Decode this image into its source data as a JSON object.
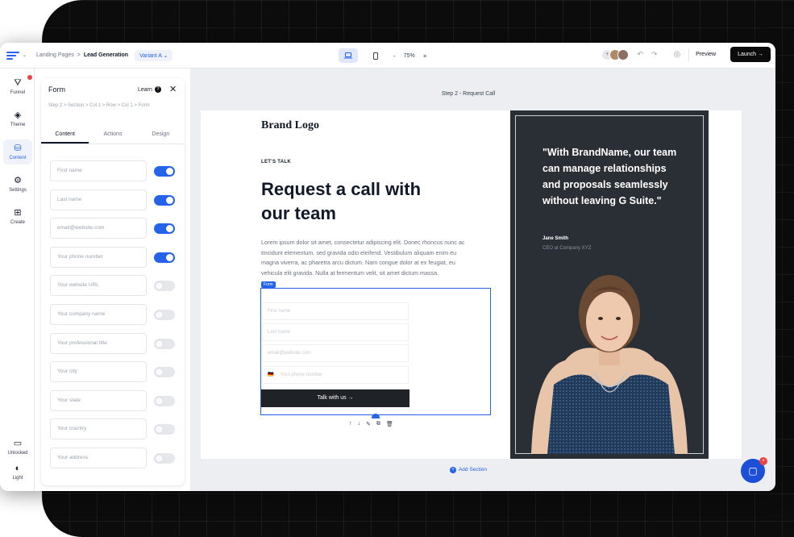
{
  "header": {
    "breadcrumb": [
      "Landing Pages",
      ">",
      "Lead Generation"
    ],
    "variant": "Variant A",
    "zoom": "75%",
    "preview_label": "Preview",
    "launch_label": "Launch"
  },
  "sidebar": {
    "items": [
      {
        "label": "Funnel",
        "icon": "funnel-icon"
      },
      {
        "label": "Theme",
        "icon": "theme-icon"
      },
      {
        "label": "Content",
        "icon": "content-icon",
        "active": true
      },
      {
        "label": "Settings",
        "icon": "settings-icon"
      },
      {
        "label": "Create",
        "icon": "create-icon"
      }
    ],
    "bottom": [
      {
        "label": "Unlocked",
        "icon": "monitor-icon"
      },
      {
        "label": "Light",
        "icon": "light-mode-icon"
      }
    ]
  },
  "panel": {
    "title": "Form",
    "learn": "Learn",
    "breadcrumb": "Step 2 > Section > Col 1 > Row > Col 1 > Form",
    "tabs": [
      "Content",
      "Actions",
      "Design"
    ],
    "active_tab": "Content",
    "fields": [
      {
        "label": "First name",
        "enabled": true
      },
      {
        "label": "Last name",
        "enabled": true
      },
      {
        "label": "email@website.com",
        "enabled": true
      },
      {
        "label": "Your phone number",
        "enabled": true
      },
      {
        "label": "Your website URL",
        "enabled": false
      },
      {
        "label": "Your company name",
        "enabled": false
      },
      {
        "label": "Your professional title",
        "enabled": false
      },
      {
        "label": "Your city",
        "enabled": false
      },
      {
        "label": "Your state",
        "enabled": false
      },
      {
        "label": "Your country",
        "enabled": false
      },
      {
        "label": "Your address",
        "enabled": false
      }
    ]
  },
  "canvas": {
    "step_label": "Step 2 - Request Call",
    "brand_logo": "Brand Logo",
    "eyebrow": "LET'S TALK",
    "headline": "Request a call with our team",
    "body": "Lorem ipsum dolor sit amet, consectetur adipiscing elit. Donec rhoncus nunc ac tincidunt elementum, sed gravida odio eleifend. Vestibulum aliquam enim eu magna viverra, ac pharetra arcu dictum. Nam congue dolor at ex feugiat, eu vehicula elit gravida. Nulla at fermentum velit, sit amet dictum massa.",
    "form_tag": "Form",
    "form_inputs": {
      "first": "First name",
      "last": "Last name",
      "email": "email@website.com",
      "phone_code": "🇩🇪",
      "phone": "Your phone number"
    },
    "cta": "Talk with us →",
    "quote": "\"With BrandName, our team can manage relationships and proposals seamlessly without leaving G Suite.\"",
    "quote_name": "Jane Smith",
    "quote_role": "CEO at Company XYZ",
    "add_section": "Add Section"
  },
  "colors": {
    "accent": "#2563eb",
    "dark": "#2a2f36"
  }
}
